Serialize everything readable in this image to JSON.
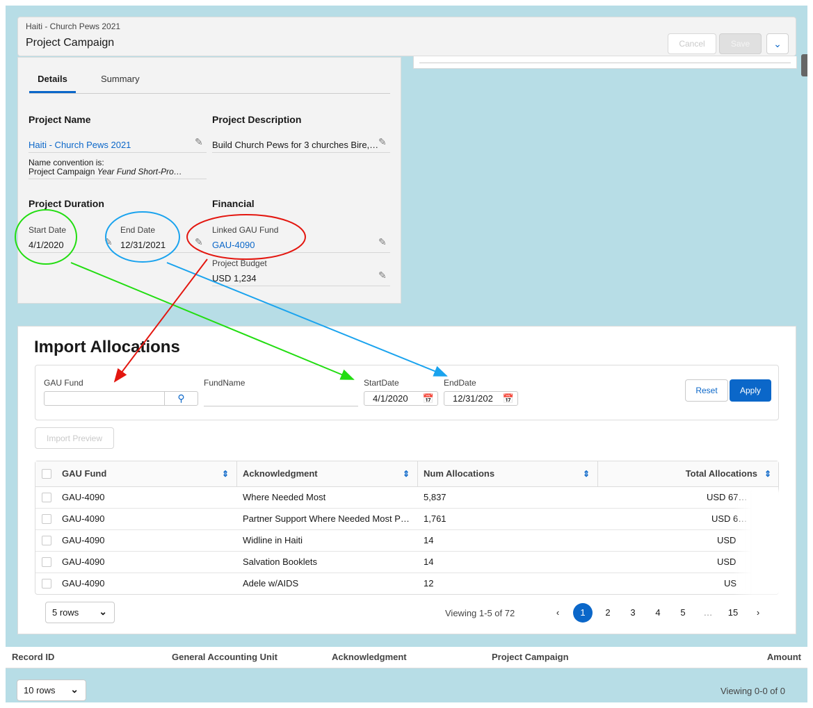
{
  "header": {
    "breadcrumb": "Haiti - Church Pews 2021",
    "title": "Project Campaign",
    "cancel_label": "Cancel",
    "save_label": "Save",
    "menu_icon": "chevron-down-icon"
  },
  "details": {
    "tabs": [
      "Details",
      "Summary"
    ],
    "project_name_heading": "Project Name",
    "project_name_value": "Haiti - Church Pews 2021",
    "name_convention_line1": "Name convention is:",
    "name_convention_line2_plain": "Project Campaign ",
    "name_convention_line2_italic": "Year Fund Short-Pro…",
    "project_description_heading": "Project Description",
    "project_description_value": "Build Church Pews for 3 churches Bire,…",
    "duration_heading": "Project Duration",
    "start_date_label": "Start Date",
    "start_date_value": "4/1/2020",
    "end_date_label": "End Date",
    "end_date_value": "12/31/2021",
    "financial_heading": "Financial",
    "gau_fund_label": "Linked GAU Fund",
    "gau_fund_value": "GAU-4090",
    "budget_label": "Project Budget",
    "budget_value": "USD 1,234"
  },
  "import": {
    "title": "Import Allocations",
    "filters": {
      "gau_fund_label": "GAU Fund",
      "gau_fund_value": "",
      "fundname_label": "FundName",
      "start_label": "StartDate",
      "start_value": "4/1/2020",
      "end_label": "EndDate",
      "end_value": "12/31/202",
      "reset_label": "Reset",
      "apply_label": "Apply"
    },
    "preview_label": "Import Preview",
    "columns": [
      "GAU Fund",
      "Acknowledgment",
      "Num Allocations",
      "Total Allocations"
    ],
    "rows": [
      {
        "fund": "GAU-4090",
        "ack": "Where Needed Most",
        "num": "5,837",
        "total": "USD 67…"
      },
      {
        "fund": "GAU-4090",
        "ack": "Partner Support Where Needed Most P…",
        "num": "1,761",
        "total": "USD 6…"
      },
      {
        "fund": "GAU-4090",
        "ack": "Widline in Haiti",
        "num": "14",
        "total": "USD"
      },
      {
        "fund": "GAU-4090",
        "ack": "Salvation Booklets",
        "num": "14",
        "total": "USD"
      },
      {
        "fund": "GAU-4090",
        "ack": "Adele w/AIDS",
        "num": "12",
        "total": "US"
      }
    ],
    "rows_select": "5 rows",
    "viewing": "Viewing 1-5 of 72",
    "pages": [
      "1",
      "2",
      "3",
      "4",
      "5",
      "…",
      "15"
    ],
    "current_page": "1"
  },
  "bottom": {
    "columns": [
      "Record ID",
      "General Accounting Unit",
      "Acknowledgment",
      "Project Campaign",
      "Amount"
    ],
    "rows_select": "10 rows",
    "viewing": "Viewing 0-0 of 0"
  },
  "annotations": {
    "green": "#22dd11",
    "blue": "#1aa3ee",
    "red": "#e3160f"
  }
}
